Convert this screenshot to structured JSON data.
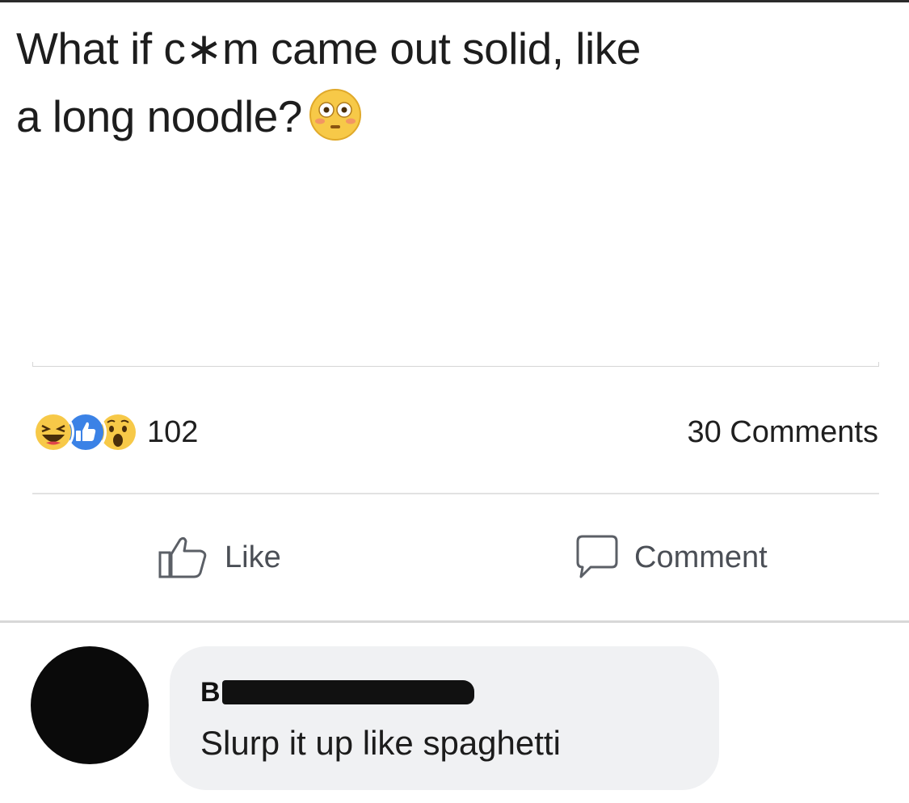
{
  "post": {
    "text_line_1": "What if c∗m came out solid, like",
    "text_line_2": "a long noodle?",
    "inline_emoji": "flushed-face-emoji"
  },
  "stats": {
    "reactions": [
      "laughing-face-icon",
      "like-thumb-icon",
      "wow-face-icon"
    ],
    "reaction_count": "102",
    "comments_count_label": "30 Comments"
  },
  "actions": {
    "like_label": "Like",
    "comment_label": "Comment"
  },
  "comment": {
    "author_initial": "B",
    "author_redacted": true,
    "text": "Slurp it up like spaghetti"
  },
  "colors": {
    "text": "#1d1d1d",
    "action_text": "#4b4f56",
    "bubble_bg": "#f0f1f3",
    "like_blue": "#3b82e6",
    "emoji_yellow": "#f7c948"
  }
}
